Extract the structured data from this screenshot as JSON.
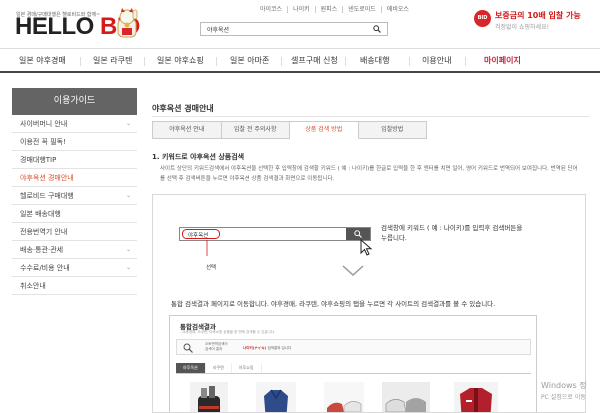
{
  "header": {
    "tagline": "일본 경매/구매대행은 헬로비드와 함께~",
    "logo_hello": "HELLO ",
    "logo_bid": "BID",
    "top_links": [
      "아이코스",
      "나이키",
      "원피스",
      "넨도로이드",
      "에비오스"
    ],
    "search_value": "야후옥션",
    "promo_badge": "BID",
    "promo_line1": "보증금의 10배 입찰 가능",
    "promo_line2": "걱정없이 쇼핑하세요!"
  },
  "nav": {
    "items": [
      "일본 야후경매",
      "일본 라쿠텐",
      "일본 야후쇼핑",
      "일본 아마존",
      "셀프구매 신청",
      "배송대행",
      "이용안내",
      "마이페이지"
    ]
  },
  "sidebar": {
    "title": "이용가이드",
    "items": [
      "사이버머니 안내",
      "이용전 꼭 필독!",
      "경매대행TIP",
      "야후옥션 경매안내",
      "헬로비드 구매대행",
      "일본 배송대행",
      "전용번역기 안내",
      "배송·통관·관세",
      "수수료/비용 안내",
      "취소안내"
    ]
  },
  "main": {
    "title": "야후옥션 경매안내",
    "tabs": [
      "야후옥션 안내",
      "입찰 전 주의사항",
      "상품 검색 방법",
      "입찰방법"
    ],
    "section_heading": "1. 키워드로 야후옥션 상품검색",
    "section_desc": "사이트 상단의 키워드검색에서 야후옥션을 선택한 후 입력창에 검색할 키워드 ( 예 : 나이키)를 한글로 입력을 한 후 엔터를 치면 일어, 영어 키워드로 번역되어 보여집니다. 번역된 단어를 선택 후 검색버튼을 누르면 야후옥션 상품 검색결과 화면으로 이동됩니다.",
    "demo_search_value": "야후옥션",
    "demo_note_line1": "검색창에 키워드 ( 예 : 나이키)를 입력후 검색버튼을",
    "demo_note_line2": "누릅니다.",
    "demo_mark": "선택",
    "result_caption": "통합 검색결과 페이지로 이동합니다. 야후경매, 라쿠텐, 야후쇼핑의 탭을 누르면 각 사이트의 검색결과를 볼 수 있습니다.",
    "result_box": {
      "title": "통합검색결과",
      "desc": "- 야후경매, 라쿠텐, 야후쇼핑 상품을 한 번에 검색할 수 있습니다.",
      "search_label1": "오토번역검색어",
      "search_label2": "검색어 결과",
      "result_text": "나이키(ナイキ)",
      "result_suffix": " 검색결과 입니다",
      "tabs": [
        "야후옥션",
        "라쿠텐",
        "야후쇼핑"
      ]
    }
  },
  "watermark": {
    "line1": "Windows 정",
    "line2": "PC 설정으로 이동"
  },
  "colors": {
    "brand_red": "#d31b1b",
    "sidebar_header": "#646464",
    "active_tab": "#d94f2a"
  }
}
